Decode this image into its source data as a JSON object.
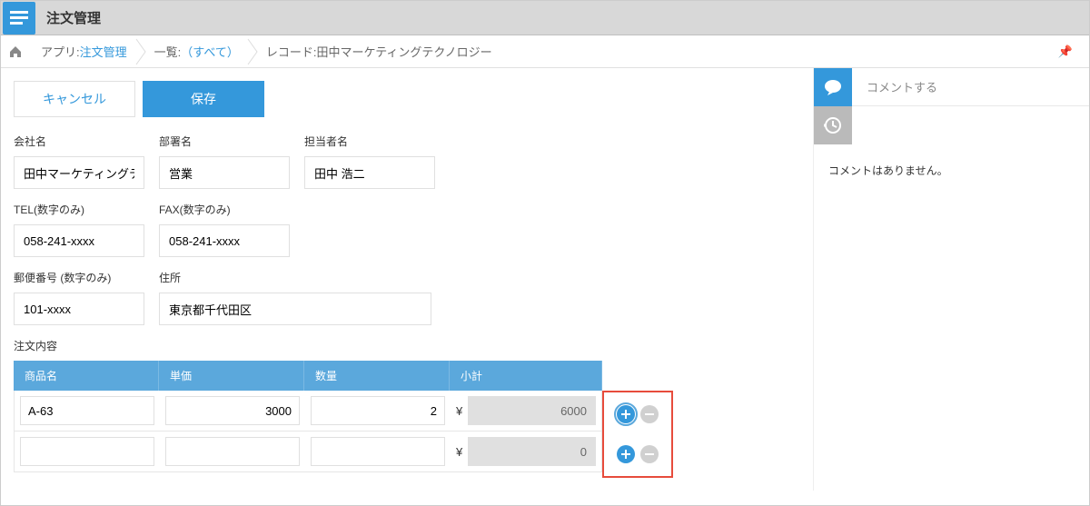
{
  "app": {
    "title": "注文管理"
  },
  "breadcrumb": {
    "app_label": "アプリ:",
    "app_name": "注文管理",
    "list_label": "一覧:",
    "list_name": "（すべて）",
    "record_label": "レコード:",
    "record_name": "田中マーケティングテクノロジー"
  },
  "actions": {
    "cancel": "キャンセル",
    "save": "保存"
  },
  "fields": {
    "company": {
      "label": "会社名",
      "value": "田中マーケティングテクノロジー"
    },
    "department": {
      "label": "部署名",
      "value": "営業"
    },
    "contact": {
      "label": "担当者名",
      "value": "田中 浩二"
    },
    "tel": {
      "label": "TEL(数字のみ)",
      "value": "058-241-xxxx"
    },
    "fax": {
      "label": "FAX(数字のみ)",
      "value": "058-241-xxxx"
    },
    "postal": {
      "label": "郵便番号 (数字のみ)",
      "value": "101-xxxx"
    },
    "address": {
      "label": "住所",
      "value": "東京都千代田区"
    }
  },
  "order": {
    "section_label": "注文内容",
    "headers": {
      "name": "商品名",
      "price": "単価",
      "qty": "数量",
      "subtotal": "小計"
    },
    "currency": "¥",
    "rows": [
      {
        "name": "A-63",
        "price": "3000",
        "qty": "2",
        "subtotal": "6000"
      },
      {
        "name": "",
        "price": "",
        "qty": "",
        "subtotal": "0"
      }
    ]
  },
  "comments": {
    "placeholder": "コメントする",
    "empty": "コメントはありません。"
  }
}
